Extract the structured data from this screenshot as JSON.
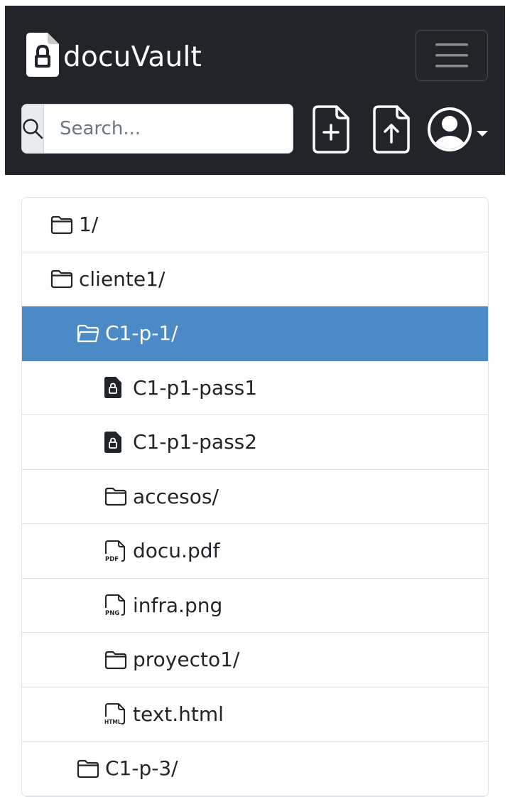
{
  "brand": {
    "name": "docuVault",
    "icon": "file-lock-icon"
  },
  "header": {
    "toggler_icon": "hamburger-icon",
    "search": {
      "placeholder": "Search...",
      "value": "",
      "icon": "search-icon"
    },
    "actions": [
      {
        "name": "new-file",
        "icon": "file-plus-icon"
      },
      {
        "name": "upload-file",
        "icon": "file-arrow-up-icon"
      },
      {
        "name": "user-menu",
        "icon": "person-circle-icon"
      }
    ]
  },
  "colors": {
    "navbar": "#212529",
    "active_row": "#4c8ac7",
    "border": "#dee2e6"
  },
  "tree": {
    "items": [
      {
        "label": "1/",
        "type": "folder",
        "icon": "folder-icon",
        "level": 0,
        "active": false
      },
      {
        "label": "cliente1/",
        "type": "folder",
        "icon": "folder-icon",
        "level": 0,
        "active": false
      },
      {
        "label": "C1-p-1/",
        "type": "folder",
        "icon": "folder-open-icon",
        "level": 1,
        "active": true
      },
      {
        "label": "C1-p1-pass1",
        "type": "password",
        "icon": "file-lock-icon",
        "level": 2,
        "active": false
      },
      {
        "label": "C1-p1-pass2",
        "type": "password",
        "icon": "file-lock-icon",
        "level": 2,
        "active": false
      },
      {
        "label": "accesos/",
        "type": "folder",
        "icon": "folder-icon",
        "level": 2,
        "active": false
      },
      {
        "label": "docu.pdf",
        "type": "pdf",
        "icon": "file-pdf-icon",
        "level": 2,
        "active": false
      },
      {
        "label": "infra.png",
        "type": "png",
        "icon": "file-png-icon",
        "level": 2,
        "active": false
      },
      {
        "label": "proyecto1/",
        "type": "folder",
        "icon": "folder-icon",
        "level": 2,
        "active": false
      },
      {
        "label": "text.html",
        "type": "html",
        "icon": "file-html-icon",
        "level": 2,
        "active": false
      },
      {
        "label": "C1-p-3/",
        "type": "folder",
        "icon": "folder-icon",
        "level": 1,
        "active": false
      }
    ]
  }
}
